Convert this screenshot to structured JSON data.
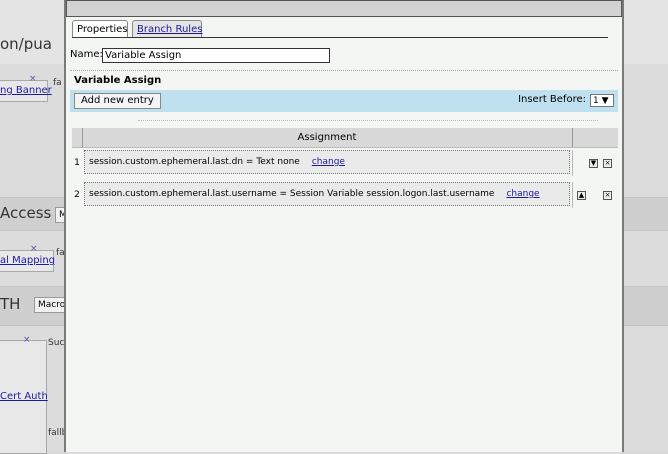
{
  "background": {
    "title_top": "on/pua",
    "node1_link": "ng Banner",
    "node1_fallback": "fa",
    "section2_title": "Access",
    "section2_input": "M",
    "node2_link": "al Mapping",
    "node2_fallback": "fa",
    "section3_title": "TH",
    "section3_input": "Macro",
    "node3_link": "Cert Auth",
    "node3_success": "Suc",
    "node3_fallback": "fallb",
    "close_x": "×"
  },
  "modal": {
    "tabs": [
      {
        "label": "Properties",
        "active": true
      },
      {
        "label": "Branch Rules",
        "active": false
      }
    ],
    "name_label": "Name:",
    "name_value": "Variable Assign",
    "section_title": "Variable Assign",
    "add_button": "Add new entry",
    "insert_before_label": "Insert Before:",
    "insert_before_value": "1 ▼",
    "table": {
      "header": "Assignment",
      "rows": [
        {
          "index": "1",
          "text": "session.custom.ephemeral.last.dn = Text none",
          "link": "change",
          "up": false,
          "down": true
        },
        {
          "index": "2",
          "text": "session.custom.ephemeral.last.username = Session Variable session.logon.last.username",
          "link": "change",
          "up": true,
          "down": false
        }
      ]
    }
  },
  "icons": {
    "move_down": "▼",
    "move_up": "▲",
    "delete": "×"
  }
}
